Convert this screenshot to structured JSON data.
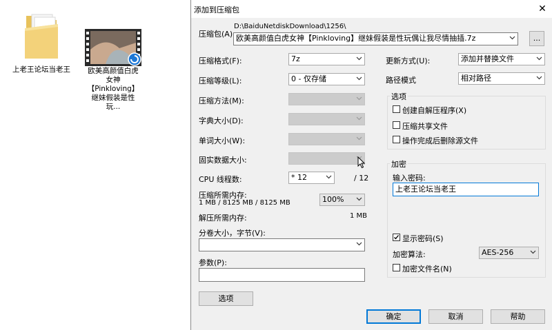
{
  "desktop": {
    "folder": {
      "label": "上老王论坛当老王"
    },
    "video": {
      "label": "欧美高颜值白虎女神【Pinkloving】继妹假装是性玩..."
    }
  },
  "dialog": {
    "title": "添加到压缩包",
    "archive": {
      "label": "压缩包(A)",
      "path": "D:\\BaiduNetdiskDownload\\1256\\",
      "value": "欧美高颜值白虎女神【Pinkloving】继妹假装是性玩偶让我尽情抽插.7z",
      "browse": "..."
    },
    "left": {
      "format": {
        "label": "压缩格式(F):",
        "value": "7z"
      },
      "level": {
        "label": "压缩等级(L):",
        "value": "0 - 仅存储"
      },
      "method": {
        "label": "压缩方法(M):"
      },
      "dict": {
        "label": "字典大小(D):"
      },
      "word": {
        "label": "单词大小(W):"
      },
      "solid": {
        "label": "固实数据大小:"
      },
      "cpu": {
        "label": "CPU 线程数:",
        "value": "* 12",
        "max": "/ 12"
      },
      "mem_comp": {
        "label": "压缩所需内存:",
        "detail": "1 MB / 8125 MB / 8125 MB",
        "pct": "100%"
      },
      "mem_decomp": {
        "label": "解压所需内存:",
        "value": "1 MB"
      },
      "split": {
        "label": "分卷大小，字节(V):"
      },
      "params": {
        "label": "参数(P):"
      },
      "options_btn": "选项"
    },
    "right": {
      "update": {
        "label": "更新方式(U):",
        "value": "添加并替换文件"
      },
      "pathmode": {
        "label": "路径模式",
        "value": "相对路径"
      },
      "options": {
        "title": "选项",
        "sfx": "创建自解压程序(X)",
        "shared": "压缩共享文件",
        "delete": "操作完成后删除源文件"
      },
      "encrypt": {
        "title": "加密",
        "pw_label": "输入密码:",
        "pw_value": "上老王论坛当老王",
        "show_pw": "显示密码(S)",
        "method_label": "加密算法:",
        "method_value": "AES-256",
        "enc_names": "加密文件名(N)"
      }
    },
    "buttons": {
      "ok": "确定",
      "cancel": "取消",
      "help": "帮助"
    }
  }
}
